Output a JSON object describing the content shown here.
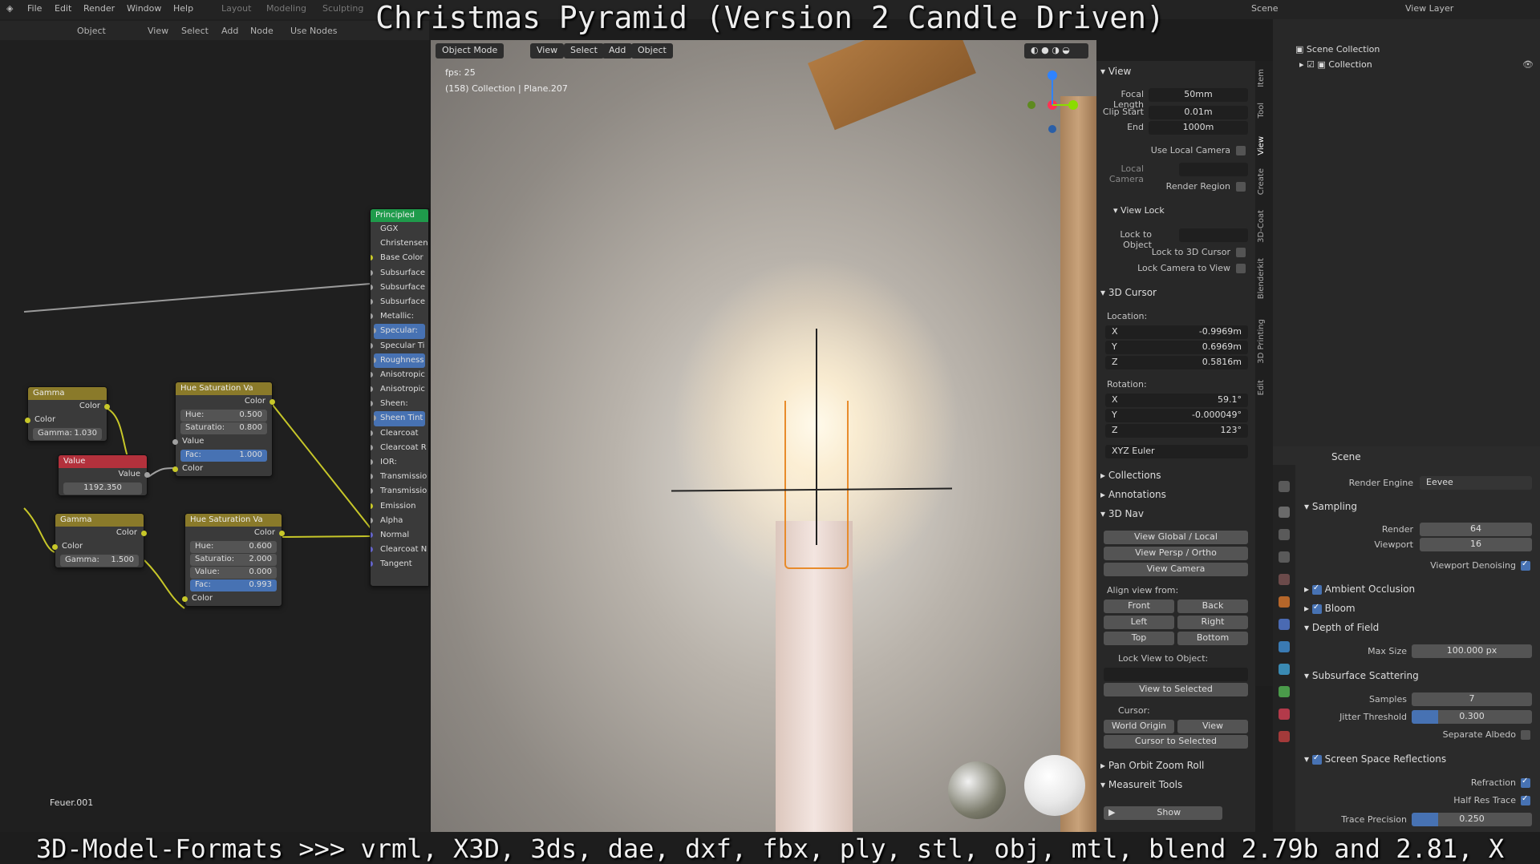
{
  "overlay": {
    "title": "Christmas Pyramid (Version 2 Candle Driven)",
    "bottom": "3D-Model-Formats >>> vrml, X3D, 3ds, dae, dxf, fbx, ply, stl, obj, mtl, blend 2.79b and 2.81, X"
  },
  "topbar": {
    "menus": [
      "File",
      "Edit",
      "Render",
      "Window",
      "Help"
    ],
    "workspaces": [
      "Layout",
      "Modeling",
      "Sculpting"
    ],
    "scene": "Scene",
    "view_layer": "View Layer"
  },
  "node_editor": {
    "header": [
      "Object",
      "View",
      "Select",
      "Add",
      "Node",
      "Use Nodes"
    ],
    "footer_label": "Feuer.001",
    "nodes": {
      "gamma1": {
        "title": "Gamma",
        "out": "Color",
        "in": "Color",
        "field_label": "Gamma:",
        "field_value": "1.030"
      },
      "value": {
        "title": "Value",
        "out": "Value",
        "field_value": "1192.350"
      },
      "gamma2": {
        "title": "Gamma",
        "out": "Color",
        "in": "Color",
        "field_label": "Gamma:",
        "field_value": "1.500"
      },
      "hsv1": {
        "title": "Hue Saturation Va",
        "out": "Color",
        "hue_label": "Hue:",
        "hue": "0.500",
        "sat_label": "Saturatio:",
        "sat": "0.800",
        "value_label": "Value",
        "fac_label": "Fac:",
        "fac": "1.000",
        "color_label": "Color"
      },
      "hsv2": {
        "title": "Hue Saturation Va",
        "out": "Color",
        "hue_label": "Hue:",
        "hue": "0.600",
        "sat_label": "Saturatio:",
        "sat": "2.000",
        "value_label": "Value:",
        "value": "0.000",
        "fac_label": "Fac:",
        "fac": "0.993",
        "color_label": "Color"
      },
      "principled": {
        "title": "Principled",
        "rows": [
          "GGX",
          "Christensen",
          "Base Color",
          "Subsurface",
          "Subsurface",
          "Subsurface",
          "Metallic:",
          "Specular:",
          "Specular Ti",
          "Roughness",
          "Anisotropic",
          "Anisotropic",
          "Sheen:",
          "Sheen Tint",
          "Clearcoat",
          "Clearcoat R",
          "IOR:",
          "Transmissio",
          "Transmissio",
          "Emission",
          "Alpha",
          "Normal",
          "Clearcoat N",
          "Tangent"
        ]
      }
    }
  },
  "viewport": {
    "mode": "Object Mode",
    "menus": [
      "View",
      "Select",
      "Add",
      "Object"
    ],
    "fps": "fps: 25",
    "info": "(158) Collection | Plane.207"
  },
  "npanel": {
    "view_header": "View",
    "focal_length_label": "Focal Length",
    "focal_length": "50mm",
    "clip_start_label": "Clip Start",
    "clip_start": "0.01m",
    "end_label": "End",
    "end": "1000m",
    "use_local_camera": "Use Local Camera",
    "local_camera": "Local Camera",
    "render_region": "Render Region",
    "view_lock": "View Lock",
    "lock_to_object": "Lock to Object",
    "lock_to_3d_cursor": "Lock to 3D Cursor",
    "lock_camera_to_view": "Lock Camera to View",
    "cursor_header": "3D Cursor",
    "location": "Location:",
    "loc_x": "-0.9969m",
    "loc_y": "0.6969m",
    "loc_z": "0.5816m",
    "rotation": "Rotation:",
    "rot_x": "59.1°",
    "rot_y": "-0.000049°",
    "rot_z": "123°",
    "rotation_mode": "XYZ Euler",
    "collections": "Collections",
    "annotations": "Annotations",
    "nav_3d": "3D Nav",
    "view_global_local": "View Global / Local",
    "view_persp_ortho": "View Persp / Ortho",
    "view_camera": "View Camera",
    "align_view_from": "Align view from:",
    "align": [
      "Front",
      "Back",
      "Left",
      "Right",
      "Top",
      "Bottom"
    ],
    "lock_view_to_object": "Lock View to Object:",
    "view_to_selected": "View to Selected",
    "cursor": "Cursor:",
    "world_origin": "World Origin",
    "view": "View",
    "cursor_to_selected": "Cursor to Selected",
    "pan_orbit": "Pan Orbit Zoom Roll",
    "measureit": "Measureit Tools",
    "show": "Show",
    "tabs": [
      "Item",
      "Tool",
      "View",
      "Create",
      "3D-Coat",
      "Blenderkit",
      "3D Printing",
      "Edit"
    ]
  },
  "outliner": {
    "scene_collection": "Scene Collection",
    "collection": "Collection"
  },
  "properties": {
    "scene": "Scene",
    "render_engine_label": "Render Engine",
    "render_engine": "Eevee",
    "sampling": "Sampling",
    "render_label": "Render",
    "render": "64",
    "viewport_label": "Viewport",
    "viewport": "16",
    "viewport_denoising": "Viewport Denoising",
    "ambient_occlusion": "Ambient Occlusion",
    "bloom": "Bloom",
    "depth_of_field": "Depth of Field",
    "max_size_label": "Max Size",
    "max_size": "100.000 px",
    "subsurface_scattering": "Subsurface Scattering",
    "samples_label": "Samples",
    "samples": "7",
    "jitter_label": "Jitter Threshold",
    "jitter": "0.300",
    "separate_albedo": "Separate Albedo",
    "ssr": "Screen Space Reflections",
    "refraction": "Refraction",
    "half_res_trace": "Half Res Trace",
    "trace_precision_label": "Trace Precision",
    "trace_precision": "0.250"
  }
}
